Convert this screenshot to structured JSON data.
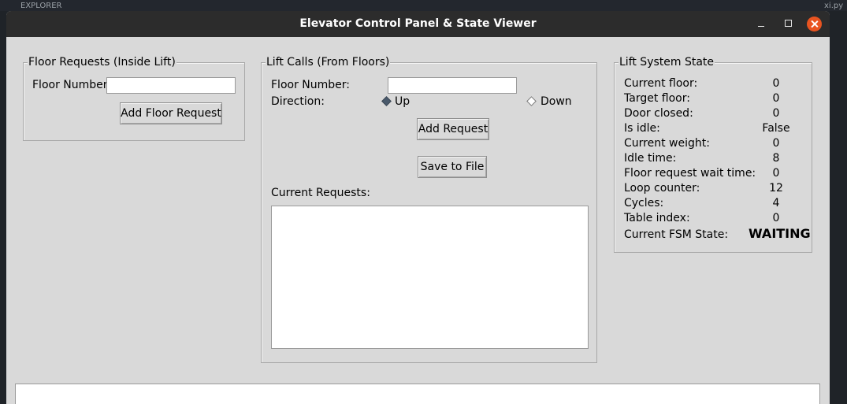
{
  "background": {
    "explorer_label": "EXPLORER",
    "file_label": "xi.py"
  },
  "window": {
    "title": "Elevator Control Panel & State Viewer",
    "close_color": "#e95420",
    "titlebar_color": "#2c2c2c"
  },
  "floor_requests": {
    "legend": "Floor Requests (Inside Lift)",
    "floor_number_label": "Floor Number:",
    "floor_number_value": "",
    "add_button": "Add Floor Request"
  },
  "lift_calls": {
    "legend": "Lift Calls (From Floors)",
    "floor_number_label": "Floor Number:",
    "floor_number_value": "",
    "direction_label": "Direction:",
    "direction_options": [
      "Up",
      "Down"
    ],
    "direction_selected": "Up",
    "add_button": "Add Request",
    "save_button": "Save to File",
    "current_requests_label": "Current Requests:",
    "current_requests": []
  },
  "system_state": {
    "legend": "Lift System State",
    "rows": [
      {
        "label": "Current floor:",
        "value": "0"
      },
      {
        "label": "Target floor:",
        "value": "0"
      },
      {
        "label": "Door closed:",
        "value": "0"
      },
      {
        "label": "Is idle:",
        "value": "False"
      },
      {
        "label": "Current weight:",
        "value": "0"
      },
      {
        "label": "Idle time:",
        "value": "8"
      },
      {
        "label": "Floor request wait time:",
        "value": "0"
      },
      {
        "label": "Loop counter:",
        "value": "12"
      },
      {
        "label": "Cycles:",
        "value": "4"
      },
      {
        "label": "Table index:",
        "value": "0"
      }
    ],
    "fsm_label": "Current FSM State:",
    "fsm_value": "WAITING"
  }
}
